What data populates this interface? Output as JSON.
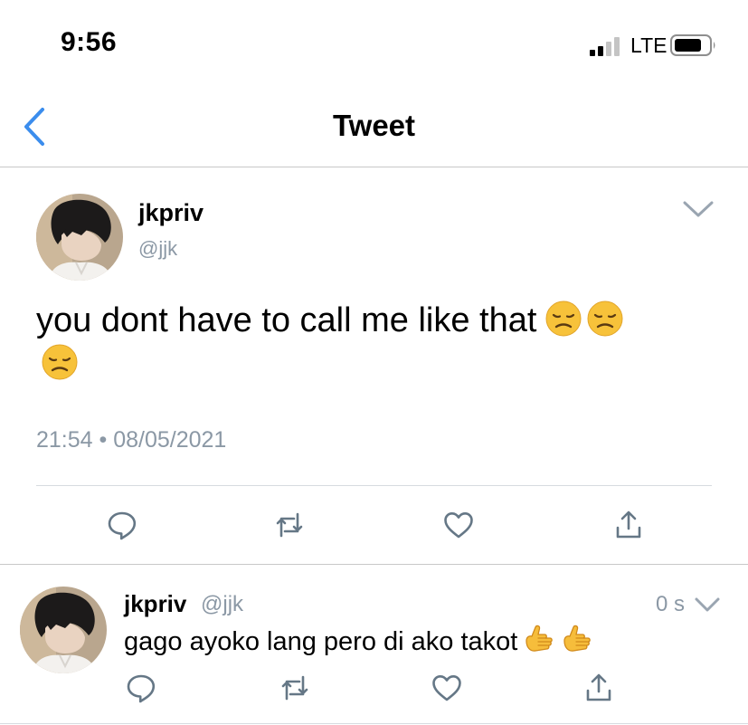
{
  "status_bar": {
    "time": "9:56",
    "network": "LTE"
  },
  "nav": {
    "title": "Tweet"
  },
  "main_tweet": {
    "display_name": "jkpriv",
    "handle": "@jjk",
    "text": "you dont have to call me like that",
    "emojis": [
      "disappointed-face-icon",
      "disappointed-face-icon",
      "disappointed-face-icon"
    ],
    "timestamp": "21:54 • 08/05/2021",
    "actions": [
      "reply-icon",
      "retweet-icon",
      "like-icon",
      "share-icon"
    ]
  },
  "reply_tweet": {
    "display_name": "jkpriv",
    "handle": "@jjk",
    "time_ago": "0 s",
    "text": "gago ayoko lang pero di ako takot",
    "emojis": [
      "call-me-hand-icon",
      "call-me-hand-icon"
    ],
    "actions": [
      "reply-icon",
      "retweet-icon",
      "like-icon",
      "share-icon"
    ]
  },
  "colors": {
    "accent": "#1d9bf0",
    "muted": "#8b98a5",
    "icon_gray": "#657786",
    "emoji": "#f7c23a"
  }
}
